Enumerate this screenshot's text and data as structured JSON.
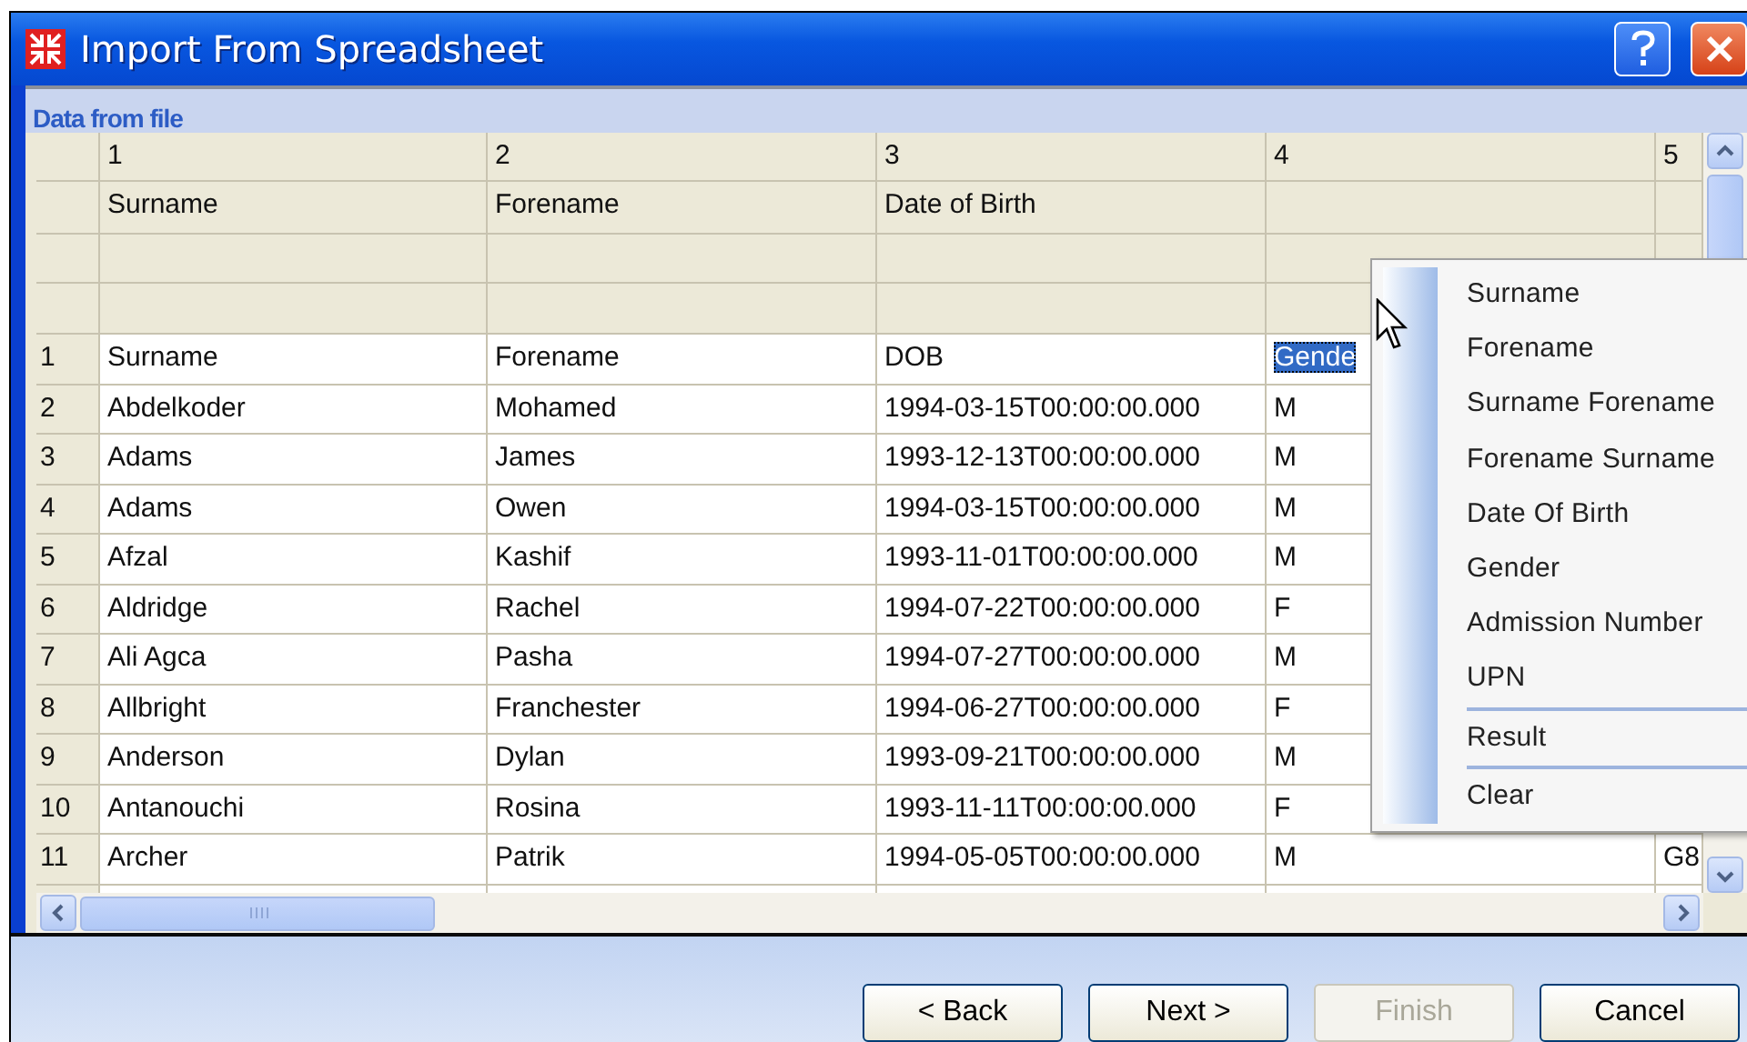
{
  "window": {
    "title": "Import From Spreadsheet"
  },
  "panel": {
    "title": "Data from file"
  },
  "grid": {
    "columns": [
      "1",
      "2",
      "3",
      "4",
      "5"
    ],
    "field_row": [
      "Surname",
      "Forename",
      "Date of Birth"
    ],
    "rows": [
      {
        "number": "1",
        "cells": [
          {
            "text": "Surname",
            "selected": false
          },
          {
            "text": "Forename",
            "selected": false
          },
          {
            "text": "DOB",
            "selected": false
          },
          {
            "text": "Gende",
            "selected": true
          }
        ]
      },
      {
        "number": "2",
        "cells": [
          {
            "text": "Abdelkoder",
            "selected": false
          },
          {
            "text": "Mohamed",
            "selected": false
          },
          {
            "text": "1994-03-15T00:00:00.000",
            "selected": false
          },
          {
            "text": "M",
            "selected": false
          }
        ]
      },
      {
        "number": "3",
        "cells": [
          {
            "text": "Adams",
            "selected": false
          },
          {
            "text": "James",
            "selected": false
          },
          {
            "text": "1993-12-13T00:00:00.000",
            "selected": false
          },
          {
            "text": "M",
            "selected": false
          }
        ]
      },
      {
        "number": "4",
        "cells": [
          {
            "text": "Adams",
            "selected": false
          },
          {
            "text": "Owen",
            "selected": false
          },
          {
            "text": "1994-03-15T00:00:00.000",
            "selected": false
          },
          {
            "text": "M",
            "selected": false
          }
        ]
      },
      {
        "number": "5",
        "cells": [
          {
            "text": "Afzal",
            "selected": false
          },
          {
            "text": "Kashif",
            "selected": false
          },
          {
            "text": "1993-11-01T00:00:00.000",
            "selected": false
          },
          {
            "text": "M",
            "selected": false
          }
        ]
      },
      {
        "number": "6",
        "cells": [
          {
            "text": "Aldridge",
            "selected": false
          },
          {
            "text": "Rachel",
            "selected": false
          },
          {
            "text": "1994-07-22T00:00:00.000",
            "selected": false
          },
          {
            "text": "F",
            "selected": false
          }
        ]
      },
      {
        "number": "7",
        "cells": [
          {
            "text": "Ali Agca",
            "selected": false
          },
          {
            "text": "Pasha",
            "selected": false
          },
          {
            "text": "1994-07-27T00:00:00.000",
            "selected": false
          },
          {
            "text": "M",
            "selected": false
          }
        ]
      },
      {
        "number": "8",
        "cells": [
          {
            "text": "Allbright",
            "selected": false
          },
          {
            "text": "Franchester",
            "selected": false
          },
          {
            "text": "1994-06-27T00:00:00.000",
            "selected": false
          },
          {
            "text": "F",
            "selected": false
          }
        ]
      },
      {
        "number": "9",
        "cells": [
          {
            "text": "Anderson",
            "selected": false
          },
          {
            "text": "Dylan",
            "selected": false
          },
          {
            "text": "1993-09-21T00:00:00.000",
            "selected": false
          },
          {
            "text": "M",
            "selected": false
          }
        ]
      },
      {
        "number": "10",
        "cells": [
          {
            "text": "Antanouchi",
            "selected": false
          },
          {
            "text": "Rosina",
            "selected": false
          },
          {
            "text": "1993-11-11T00:00:00.000",
            "selected": false
          },
          {
            "text": "F",
            "selected": false
          }
        ]
      },
      {
        "number": "11",
        "cells": [
          {
            "text": "Archer",
            "selected": false
          },
          {
            "text": "Patrik",
            "selected": false
          },
          {
            "text": "1994-05-05T00:00:00.000",
            "selected": false
          },
          {
            "text": "M",
            "selected": false
          },
          {
            "text": "G8",
            "selected": false
          }
        ]
      }
    ]
  },
  "context_menu": {
    "items": [
      {
        "label": "Surname",
        "separator_before": false
      },
      {
        "label": "Forename",
        "separator_before": false
      },
      {
        "label": "Surname Forename",
        "separator_before": false
      },
      {
        "label": "Forename Surname",
        "separator_before": false
      },
      {
        "label": "Date Of Birth",
        "separator_before": false
      },
      {
        "label": "Gender",
        "separator_before": false
      },
      {
        "label": "Admission Number",
        "separator_before": false
      },
      {
        "label": "UPN",
        "separator_before": false
      },
      {
        "label": "Result",
        "separator_before": true
      },
      {
        "label": "Clear",
        "separator_before": true
      }
    ]
  },
  "buttons": [
    {
      "label": "< Back",
      "disabled": false
    },
    {
      "label": "Next >",
      "disabled": false
    },
    {
      "label": "Finish",
      "disabled": true
    },
    {
      "label": "Cancel",
      "disabled": false
    }
  ]
}
